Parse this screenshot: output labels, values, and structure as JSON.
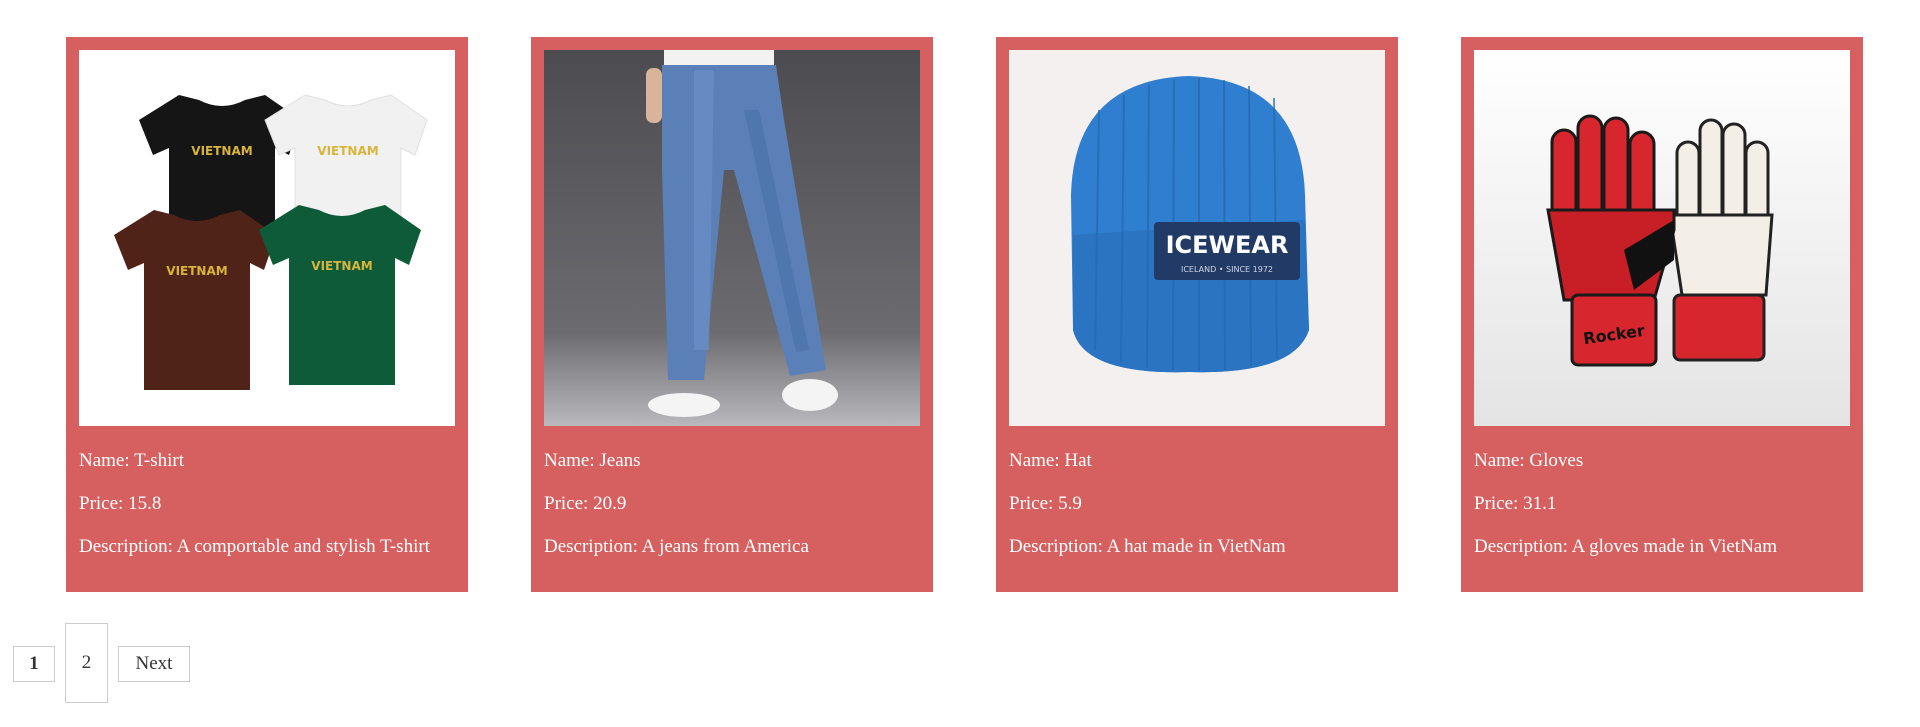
{
  "products": [
    {
      "name_label": "Name: ",
      "name": "T-shirt",
      "price_label": "Price: ",
      "price": "15.8",
      "desc_label": "Description: ",
      "description": "A comportable and stylish T-shirt"
    },
    {
      "name_label": "Name: ",
      "name": "Jeans",
      "price_label": "Price: ",
      "price": "20.9",
      "desc_label": "Description: ",
      "description": "A jeans from America"
    },
    {
      "name_label": "Name: ",
      "name": "Hat",
      "price_label": "Price: ",
      "price": "5.9",
      "desc_label": "Description: ",
      "description": "A hat made in VietNam"
    },
    {
      "name_label": "Name: ",
      "name": "Gloves",
      "price_label": "Price: ",
      "price": "31.1",
      "desc_label": "Description: ",
      "description": "A gloves made in VietNam"
    }
  ],
  "image_text": {
    "tshirt_print": "VIETNAM",
    "hat_brand": "ICEWEAR",
    "hat_sub": "ICELAND • SINCE 1972",
    "gloves_brand": "Rocker"
  },
  "pagination": {
    "pages": [
      "1",
      "2"
    ],
    "current": "1",
    "next_label": "Next"
  },
  "colors": {
    "card_bg": "#d66060",
    "card_text": "#ffffff",
    "page_bg": "#ffffff"
  }
}
